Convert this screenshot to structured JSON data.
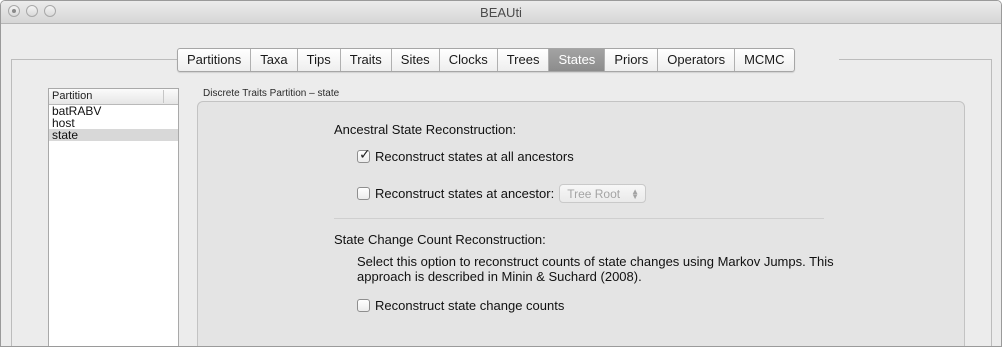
{
  "window": {
    "title": "BEAUti"
  },
  "tabs": [
    {
      "label": "Partitions",
      "active": false
    },
    {
      "label": "Taxa",
      "active": false
    },
    {
      "label": "Tips",
      "active": false
    },
    {
      "label": "Traits",
      "active": false
    },
    {
      "label": "Sites",
      "active": false
    },
    {
      "label": "Clocks",
      "active": false
    },
    {
      "label": "Trees",
      "active": false
    },
    {
      "label": "States",
      "active": true
    },
    {
      "label": "Priors",
      "active": false
    },
    {
      "label": "Operators",
      "active": false
    },
    {
      "label": "MCMC",
      "active": false
    }
  ],
  "partition_list": {
    "header": "Partition",
    "items": [
      "batRABV",
      "host",
      "state"
    ],
    "selected": "state"
  },
  "section": {
    "label": "Discrete Traits Partition – state"
  },
  "ancestral": {
    "heading": "Ancestral State Reconstruction:",
    "reconstruct_all_label": "Reconstruct states at all ancestors",
    "reconstruct_all_checked": true,
    "reconstruct_at_label": "Reconstruct states at ancestor:",
    "reconstruct_at_checked": false,
    "ancestor_dropdown_value": "Tree Root"
  },
  "state_change": {
    "heading": "State Change Count Reconstruction:",
    "description": "Select this option to reconstruct counts of state changes using Markov Jumps. This approach is described in Minin & Suchard (2008).",
    "reconstruct_counts_label": "Reconstruct state change counts",
    "reconstruct_counts_checked": false
  }
}
